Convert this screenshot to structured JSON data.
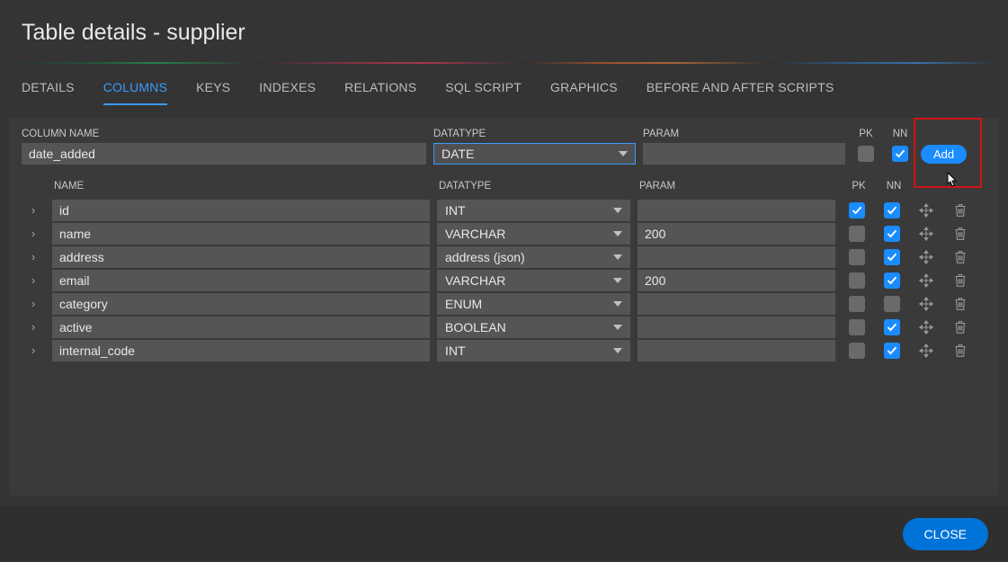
{
  "title": "Table details - supplier",
  "tabs": [
    {
      "label": "DETAILS",
      "active": false
    },
    {
      "label": "COLUMNS",
      "active": true
    },
    {
      "label": "KEYS",
      "active": false
    },
    {
      "label": "INDEXES",
      "active": false
    },
    {
      "label": "RELATIONS",
      "active": false
    },
    {
      "label": "SQL SCRIPT",
      "active": false
    },
    {
      "label": "GRAPHICS",
      "active": false
    },
    {
      "label": "BEFORE AND AFTER SCRIPTS",
      "active": false
    }
  ],
  "headers": {
    "column_name": "COLUMN NAME",
    "datatype": "DATATYPE",
    "param": "PARAM",
    "pk": "PK",
    "nn": "NN",
    "name": "NAME"
  },
  "new_column": {
    "name": "date_added",
    "datatype": "DATE",
    "param": "",
    "pk": false,
    "nn": true
  },
  "add_button": "Add",
  "columns": [
    {
      "name": "id",
      "datatype": "INT",
      "param": "",
      "pk": true,
      "nn": true
    },
    {
      "name": "name",
      "datatype": "VARCHAR",
      "param": "200",
      "pk": false,
      "nn": true
    },
    {
      "name": "address",
      "datatype": "address (json)",
      "param": "",
      "pk": false,
      "nn": true
    },
    {
      "name": "email",
      "datatype": "VARCHAR",
      "param": "200",
      "pk": false,
      "nn": true
    },
    {
      "name": "category",
      "datatype": "ENUM",
      "param": "",
      "pk": false,
      "nn": false
    },
    {
      "name": "active",
      "datatype": "BOOLEAN",
      "param": "",
      "pk": false,
      "nn": true
    },
    {
      "name": "internal_code",
      "datatype": "INT",
      "param": "",
      "pk": false,
      "nn": true
    }
  ],
  "close_button": "CLOSE"
}
